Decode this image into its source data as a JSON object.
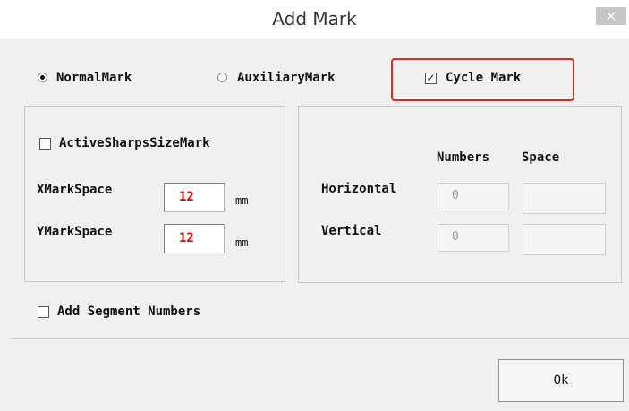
{
  "window": {
    "title": "Add Mark",
    "close_glyph": "×"
  },
  "mode": {
    "normal_label": "NormalMark",
    "auxiliary_label": "AuxiliaryMark",
    "cycle_label": "Cycle Mark",
    "cycle_checked": true,
    "selected": "NormalMark"
  },
  "left_group": {
    "active_label": "ActiveSharpsSizeMark",
    "x_label": "XMarkSpace",
    "x_value": "12",
    "x_unit": "mm",
    "y_label": "YMarkSpace",
    "y_value": "12",
    "y_unit": "mm"
  },
  "right_group": {
    "col_numbers": "Numbers",
    "col_space": "Space",
    "horizontal_label": "Horizontal",
    "horizontal_numbers": "0",
    "horizontal_space": "",
    "vertical_label": "Vertical",
    "vertical_numbers": "0",
    "vertical_space": ""
  },
  "segment": {
    "label": "Add Segment Numbers"
  },
  "footer": {
    "ok_label": "Ok"
  },
  "colors": {
    "highlight": "#e02a20",
    "value_red": "#e00000"
  }
}
